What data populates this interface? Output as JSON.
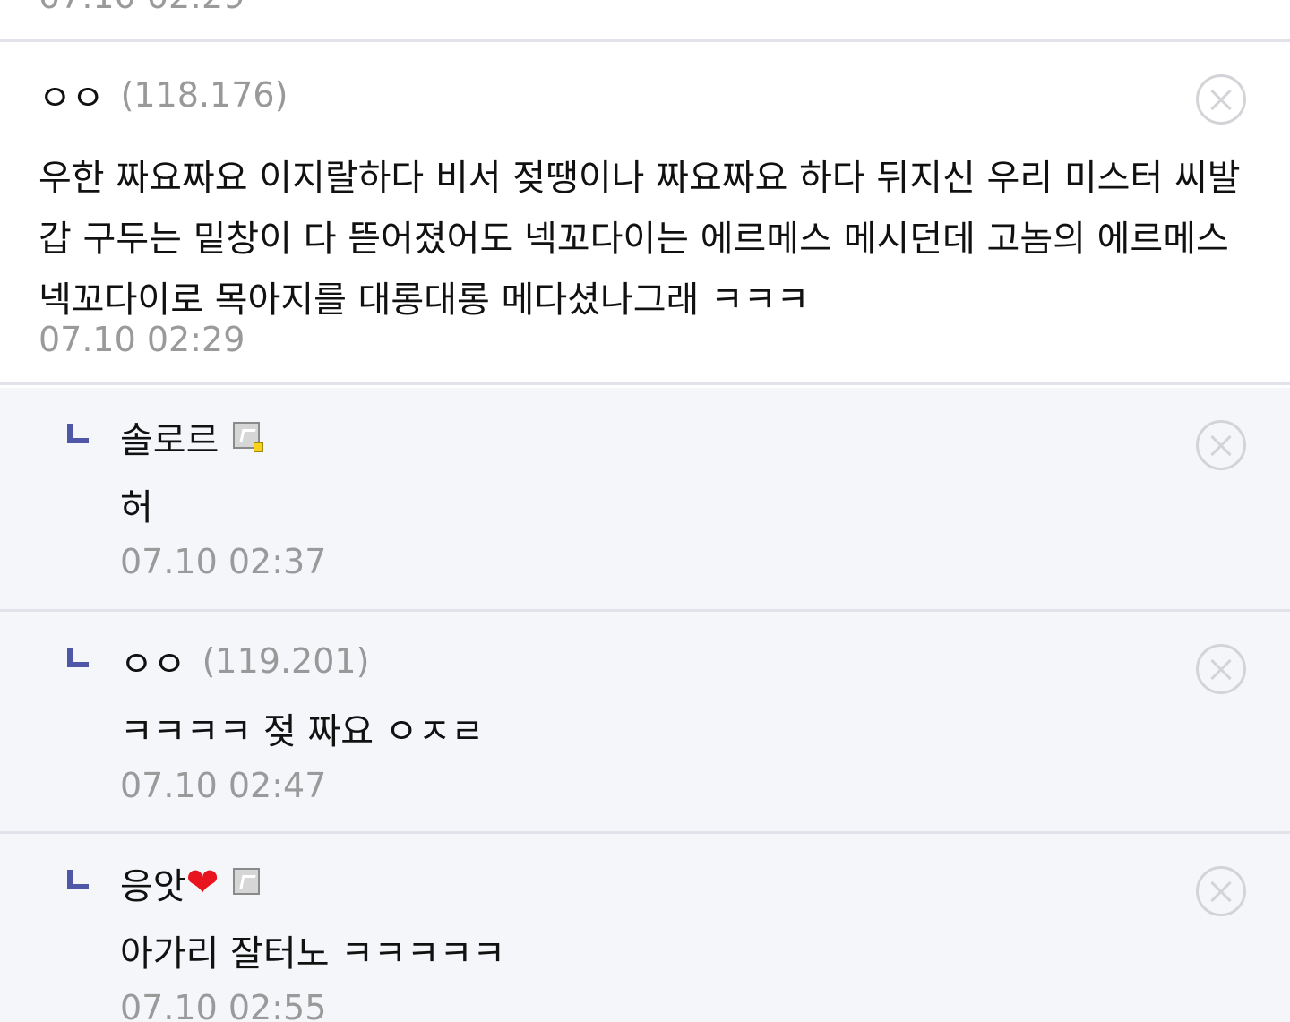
{
  "previous_comment": {
    "date": "07.10 02:29"
  },
  "comments": [
    {
      "nick": "ㅇㅇ",
      "ip": "(118.176)",
      "text": "우한 짜요짜요 이지랄하다 비서 젖땡이나 짜요짜요 하다 뒤지신 우리 미스터 씨발갑 구두는 밑창이 다 뜯어졌어도 넥꼬다이는 에르메스 메시던데 고놈의 에르메스 넥꼬다이로 목아지를 대롱대롱 메다셨나그래 ㅋㅋㅋ",
      "date": "07.10 02:29"
    }
  ],
  "replies": [
    {
      "nick": "솔로르",
      "icons": [
        "gallog-icon"
      ],
      "text": "허",
      "date": "07.10 02:37"
    },
    {
      "nick": "ㅇㅇ",
      "ip": "(119.201)",
      "text": "ㅋㅋㅋㅋ 젖 짜요 ㅇㅈㄹ",
      "date": "07.10 02:47"
    },
    {
      "nick": "응앗",
      "heart": "❤",
      "icons": [
        "gallog-icon"
      ],
      "text": "아가리 잘터노 ㅋㅋㅋㅋㅋ",
      "date": "07.10 02:55"
    }
  ],
  "colors": {
    "reply_background": "#f5f6fa",
    "divider": "#e2e3ea",
    "reply_marker": "#4f57a6",
    "muted_text": "#9a9a9a",
    "heart": "#e8141e"
  }
}
